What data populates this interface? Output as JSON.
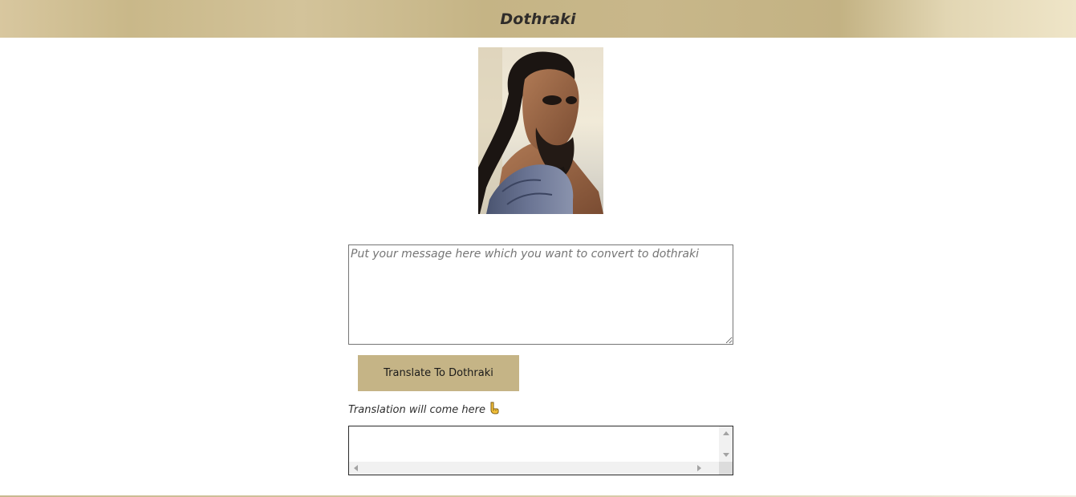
{
  "header": {
    "title": "Dothraki",
    "accent_color": "#c5b486"
  },
  "portrait": {
    "icon": "khal-drogo-portrait"
  },
  "input": {
    "value": "",
    "placeholder": "Put your message here which you want to convert to dothraki"
  },
  "translate_button": {
    "label": "Translate To Dothraki"
  },
  "output": {
    "label": "Translation will come here",
    "label_icon": "pointing-down-icon",
    "value": ""
  }
}
